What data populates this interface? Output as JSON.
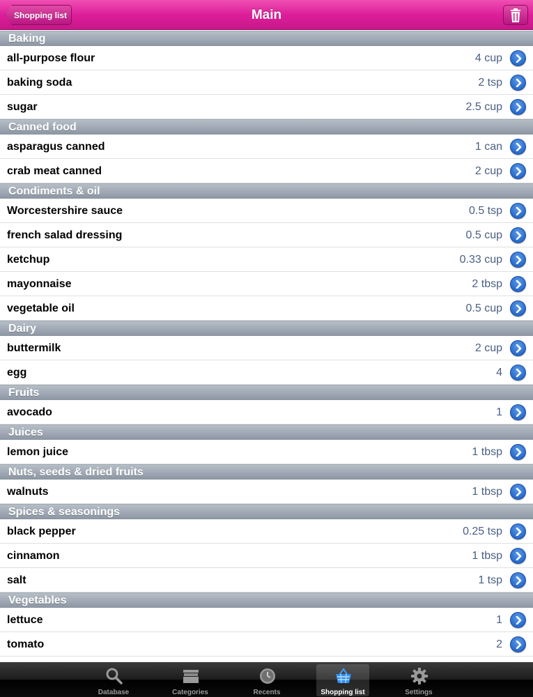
{
  "navbar": {
    "title": "Main",
    "back_label": "Shopping list",
    "trash_icon": "trash-icon"
  },
  "sections": [
    {
      "title": "Baking",
      "items": [
        {
          "name": "all-purpose flour",
          "qty": "4 cup"
        },
        {
          "name": "baking soda",
          "qty": "2 tsp"
        },
        {
          "name": "sugar",
          "qty": "2.5 cup"
        }
      ]
    },
    {
      "title": "Canned food",
      "items": [
        {
          "name": "asparagus canned",
          "qty": "1 can"
        },
        {
          "name": "crab meat canned",
          "qty": "2 cup"
        }
      ]
    },
    {
      "title": "Condiments &  oil",
      "items": [
        {
          "name": "Worcestershire sauce",
          "qty": "0.5 tsp"
        },
        {
          "name": "french salad dressing",
          "qty": "0.5 cup"
        },
        {
          "name": "ketchup",
          "qty": "0.33 cup"
        },
        {
          "name": "mayonnaise",
          "qty": "2 tbsp"
        },
        {
          "name": "vegetable oil",
          "qty": "0.5 cup"
        }
      ]
    },
    {
      "title": "Dairy",
      "items": [
        {
          "name": "buttermilk",
          "qty": "2 cup"
        },
        {
          "name": "egg",
          "qty": "4"
        }
      ]
    },
    {
      "title": "Fruits",
      "items": [
        {
          "name": "avocado",
          "qty": "1"
        }
      ]
    },
    {
      "title": "Juices",
      "items": [
        {
          "name": "lemon juice",
          "qty": "1 tbsp"
        }
      ]
    },
    {
      "title": "Nuts, seeds & dried fruits",
      "items": [
        {
          "name": "walnuts",
          "qty": "1 tbsp"
        }
      ]
    },
    {
      "title": "Spices & seasonings",
      "items": [
        {
          "name": "black pepper",
          "qty": "0.25 tsp"
        },
        {
          "name": "cinnamon",
          "qty": "1 tbsp"
        },
        {
          "name": "salt",
          "qty": "1 tsp"
        }
      ]
    },
    {
      "title": "Vegetables",
      "items": [
        {
          "name": "lettuce",
          "qty": "1"
        },
        {
          "name": "tomato",
          "qty": "2"
        }
      ]
    }
  ],
  "tabbar": {
    "tabs": [
      {
        "label": "Database",
        "icon": "search-icon"
      },
      {
        "label": "Categories",
        "icon": "boxes-icon"
      },
      {
        "label": "Recents",
        "icon": "clock-icon"
      },
      {
        "label": "Shopping list",
        "icon": "basket-icon",
        "active": true
      },
      {
        "label": "Settings",
        "icon": "gear-icon"
      }
    ]
  },
  "colors": {
    "navbar": "#dc1f99",
    "section_header": "#9aa3ae",
    "qty_text": "#4a5f83",
    "disclosure": "#2e72d2"
  }
}
